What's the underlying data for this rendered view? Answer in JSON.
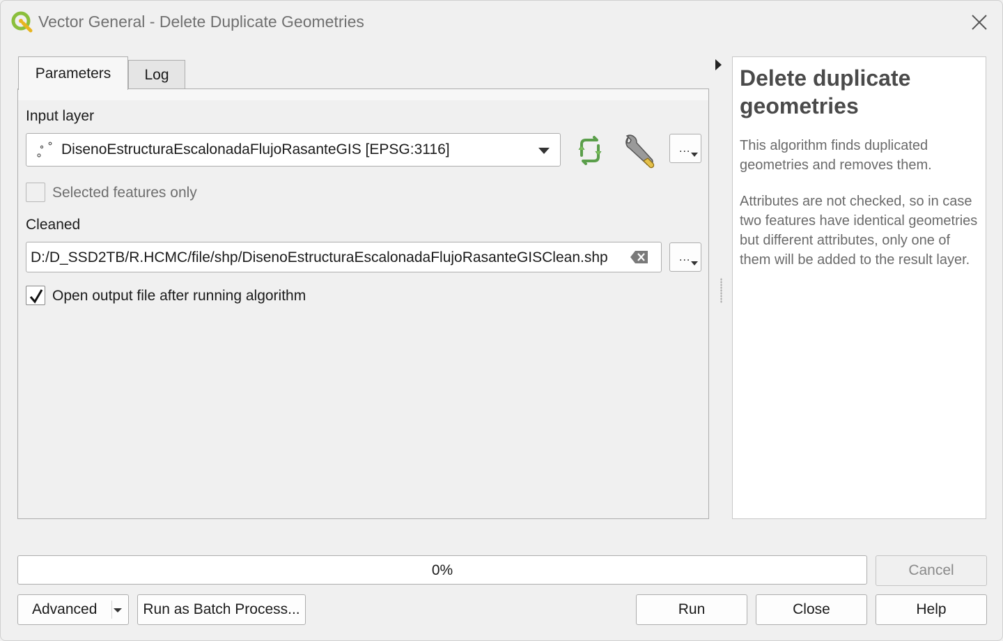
{
  "window": {
    "title": "Vector General - Delete Duplicate Geometries"
  },
  "tabs": [
    {
      "label": "Parameters",
      "active": true
    },
    {
      "label": "Log",
      "active": false
    }
  ],
  "params": {
    "input_layer_label": "Input layer",
    "input_layer_value": "DisenoEstructuraEscalonadaFlujoRasanteGIS [EPSG:3116]",
    "selected_only_label": "Selected features only",
    "selected_only_checked": false,
    "cleaned_label": "Cleaned",
    "cleaned_value": "D:/D_SSD2TB/R.HCMC/file/shp/DisenoEstructuraEscalonadaFlujoRasanteGISClean.shp",
    "open_output_label": "Open output file after running algorithm",
    "open_output_checked": true,
    "browse_label": "..."
  },
  "help": {
    "title": "Delete duplicate geometries",
    "paragraph1": "This algorithm finds duplicated geometries and removes them.",
    "paragraph2": "Attributes are not checked, so in case two features have identical geometries but different attributes, only one of them will be added to the result layer."
  },
  "progress": {
    "text": "0%",
    "value": 0
  },
  "buttons": {
    "cancel": "Cancel",
    "advanced": "Advanced",
    "batch": "Run as Batch Process...",
    "run": "Run",
    "close": "Close",
    "help": "Help"
  },
  "icons": {
    "app": "qgis-logo-icon",
    "iterate": "iterate-icon",
    "settings": "wrench-icon",
    "clear": "clear-icon",
    "close": "close-icon"
  },
  "colors": {
    "accent_green": "#6aa84f",
    "progress_fill": "#5b9bd5"
  }
}
